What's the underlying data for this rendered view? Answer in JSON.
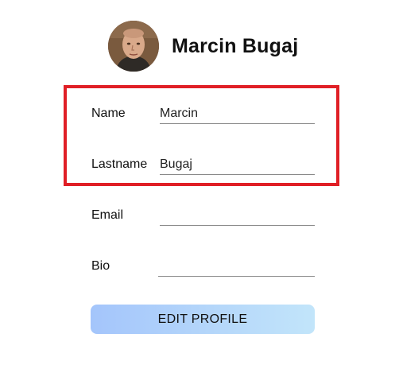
{
  "profile": {
    "avatar": "user-photo",
    "display_name": "Marcin Bugaj"
  },
  "form": {
    "name": {
      "label": "Name",
      "value": "Marcin"
    },
    "lastname": {
      "label": "Lastname",
      "value": "Bugaj"
    },
    "email": {
      "label": "Email",
      "value": ""
    },
    "bio": {
      "label": "Bio",
      "value": ""
    }
  },
  "actions": {
    "edit_label": "EDIT PROFILE"
  },
  "colors": {
    "highlight_border": "#e01f26",
    "button_gradient_start": "#a4c5fb",
    "button_gradient_end": "#c2e5fa",
    "input_underline": "#8a8a8a"
  }
}
